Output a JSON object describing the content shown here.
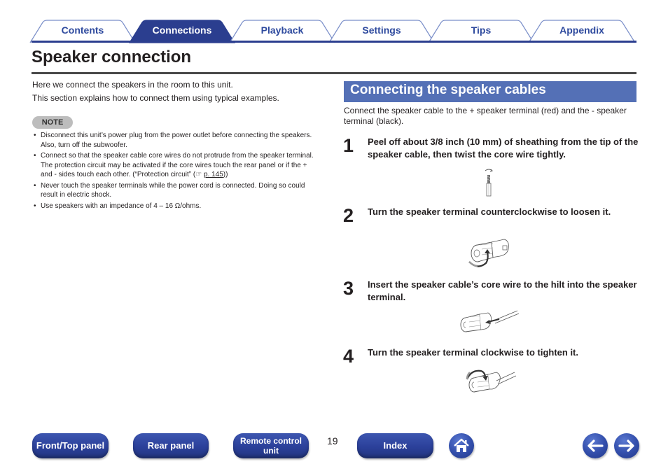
{
  "tabs": [
    {
      "label": "Contents",
      "active": false
    },
    {
      "label": "Connections",
      "active": true
    },
    {
      "label": "Playback",
      "active": false
    },
    {
      "label": "Settings",
      "active": false
    },
    {
      "label": "Tips",
      "active": false
    },
    {
      "label": "Appendix",
      "active": false
    }
  ],
  "page": {
    "title": "Speaker connection",
    "intro": [
      "Here we connect the speakers in the room to this unit.",
      "This section explains how to connect them using typical examples."
    ],
    "note_label": "NOTE",
    "notes": [
      {
        "text": "Disconnect this unit’s power plug from the power outlet before connecting the speakers. Also, turn off the subwoofer."
      },
      {
        "text": "Connect so that the speaker cable core wires do not protrude from the speaker terminal. The protection circuit may be activated if the core wires touch the rear panel or if the + and - sides touch each other. (“Protection circuit” (",
        "ref_icon": "☞",
        "link": "p. 145",
        "after": "))"
      },
      {
        "text": "Never touch the speaker terminals while the power cord is connected. Doing so could result in electric shock."
      },
      {
        "text": "Use speakers with an impedance of 4 – 16 Ω/ohms."
      }
    ]
  },
  "section": {
    "title": "Connecting the speaker cables",
    "description": "Connect the speaker cable to the + speaker terminal (red) and the - speaker terminal (black).",
    "steps": [
      {
        "number": "1",
        "text": "Peel off about 3/8 inch (10 mm) of sheathing from the tip of the speaker cable, then twist the core wire tightly.",
        "illustration": "twisted-core-wire"
      },
      {
        "number": "2",
        "text": "Turn the speaker terminal counterclockwise to loosen it.",
        "illustration": "terminal-loosen"
      },
      {
        "number": "3",
        "text": "Insert the speaker cable’s core wire to the hilt into the speaker terminal.",
        "illustration": "insert-wire"
      },
      {
        "number": "4",
        "text": "Turn the speaker terminal clockwise to tighten it.",
        "illustration": "terminal-tighten"
      }
    ]
  },
  "footer": {
    "buttons": [
      {
        "label": "Front/Top panel"
      },
      {
        "label": "Rear panel"
      },
      {
        "label": "Remote control unit"
      },
      {
        "label": "Index"
      }
    ],
    "page_number": "19",
    "home_icon": "home-icon",
    "back_icon": "arrow-left-icon",
    "forward_icon": "arrow-right-icon"
  },
  "colors": {
    "tab_active": "#2b3e8f",
    "tab_text": "#2e4a9e",
    "section_bar": "#5470b6",
    "note_badge": "#bdbdbd"
  }
}
